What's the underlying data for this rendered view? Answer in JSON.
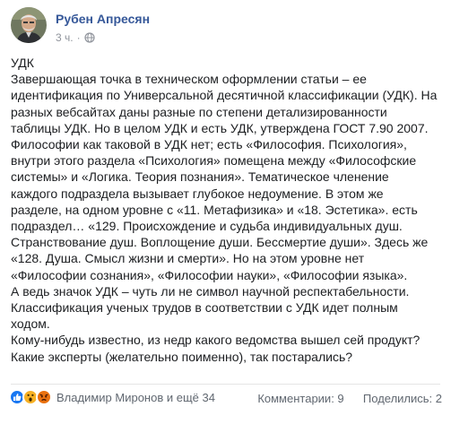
{
  "author": {
    "name": "Рубен Апресян"
  },
  "meta": {
    "time": "3 ч.",
    "separator": "·"
  },
  "post_lines": [
    "УДК",
    "Завершающая точка в техническом оформлении статьи – ее",
    "идентификация по Универсальной десятичной классификации (УДК). На",
    "разных вебсайтах даны разные по степени детализированности",
    "таблицы УДК. Но в целом УДК и есть УДК, утверждена ГОСТ 7.90 2007.",
    "Философии как таковой в УДК нет; есть «Философия. Психология»,",
    "внутри этого раздела «Психология» помещена между «Философские",
    "системы» и «Логика. Теория познания». Тематическое членение",
    "каждого подраздела вызывает глубокое недоумение. В этом же",
    "разделе, на одном уровне с «11. Метафизика» и «18. Эстетика». есть",
    "подраздел… «129. Происхождение и судьба индивидуальных душ.",
    "Странствование душ. Воплощение души. Бессмертие души». Здесь же",
    "«128. Душа. Смысл жизни и смерти». Но на этом уровне нет",
    "«Философии сознания», «Философии науки», «Философии языка».",
    "А ведь значок УДК – чуть ли не символ научной респектабельности.",
    "Классификация ученых трудов в соответствии с УДК идет полным",
    "ходом.",
    "Кому-нибудь известно, из недр какого ведомства вышел сей продукт?",
    "Какие эксперты (желательно поименно), так постарались?"
  ],
  "footer": {
    "reactions_text": "Владимир Миронов и ещё 34",
    "comments": "Комментарии: 9",
    "shares": "Поделились: 2"
  },
  "colors": {
    "link": "#365899",
    "like": "#1877f2",
    "wow": "#f7b125",
    "angry": "#e9710f"
  },
  "icons": [
    "like-icon",
    "wow-icon",
    "angry-icon",
    "globe-icon"
  ]
}
